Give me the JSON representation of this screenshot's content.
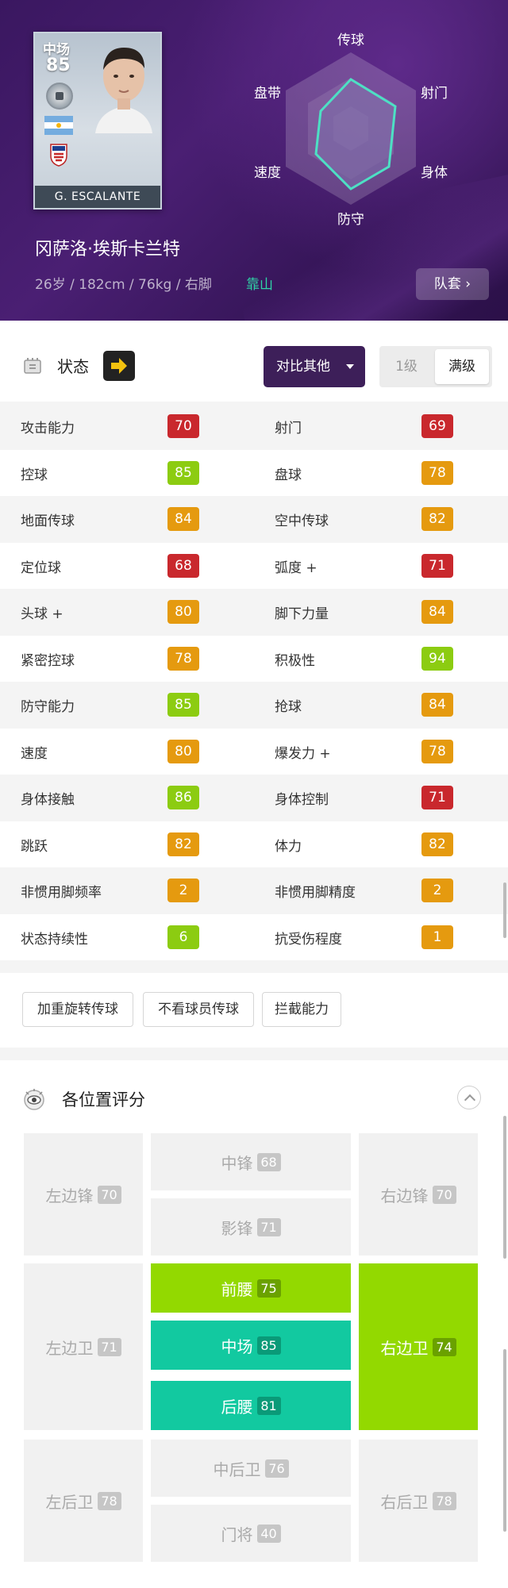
{
  "player": {
    "card_position": "中场",
    "overall": "85",
    "card_name": "G. ESCALANTE",
    "full_name": "冈萨洛·埃斯卡兰特",
    "meta": "26岁 / 182cm / 76kg / 右脚",
    "play_style": "靠山",
    "kit_button": "队套 ›"
  },
  "radar": {
    "labels": [
      "传球",
      "射门",
      "身体",
      "防守",
      "速度",
      "盘带"
    ],
    "colors": {
      "fill": "#7d6aa8",
      "outline": "#4de0c4"
    }
  },
  "status": {
    "label": "状态",
    "compare_button": "对比其他",
    "level_1": "1级",
    "level_max": "满级"
  },
  "stat_colors": {
    "red": "#c9282d",
    "orange": "#e59a0f",
    "green": "#8ccc11"
  },
  "stats": [
    {
      "l_name": "攻击能力",
      "l_val": "70",
      "l_color": "red",
      "r_name": "射门",
      "r_val": "69",
      "r_color": "red"
    },
    {
      "l_name": "控球",
      "l_val": "85",
      "l_color": "green",
      "r_name": "盘球",
      "r_val": "78",
      "r_color": "orange"
    },
    {
      "l_name": "地面传球",
      "l_val": "84",
      "l_color": "orange",
      "r_name": "空中传球",
      "r_val": "82",
      "r_color": "orange"
    },
    {
      "l_name": "定位球",
      "l_val": "68",
      "l_color": "red",
      "r_name": "弧度 +",
      "r_val": "71",
      "r_color": "red"
    },
    {
      "l_name": "头球 +",
      "l_val": "80",
      "l_color": "orange",
      "r_name": "脚下力量",
      "r_val": "84",
      "r_color": "orange"
    },
    {
      "l_name": "紧密控球",
      "l_val": "78",
      "l_color": "orange",
      "r_name": "积极性",
      "r_val": "94",
      "r_color": "green"
    },
    {
      "l_name": "防守能力",
      "l_val": "85",
      "l_color": "green",
      "r_name": "抢球",
      "r_val": "84",
      "r_color": "orange"
    },
    {
      "l_name": "速度",
      "l_val": "80",
      "l_color": "orange",
      "r_name": "爆发力 +",
      "r_val": "78",
      "r_color": "orange"
    },
    {
      "l_name": "身体接触",
      "l_val": "86",
      "l_color": "green",
      "r_name": "身体控制",
      "r_val": "71",
      "r_color": "red"
    },
    {
      "l_name": "跳跃",
      "l_val": "82",
      "l_color": "orange",
      "r_name": "体力",
      "r_val": "82",
      "r_color": "orange"
    },
    {
      "l_name": "非惯用脚频率",
      "l_val": "2",
      "l_color": "orange",
      "r_name": "非惯用脚精度",
      "r_val": "2",
      "r_color": "orange"
    },
    {
      "l_name": "状态持续性",
      "l_val": "6",
      "l_color": "green",
      "r_name": "抗受伤程度",
      "r_val": "1",
      "r_color": "orange"
    }
  ],
  "skills": [
    "加重旋转传球",
    "不看球员传球",
    "拦截能力"
  ],
  "positions": {
    "title": "各位置评分",
    "tiles": [
      {
        "name": "左边锋",
        "value": "70",
        "style": "grey"
      },
      {
        "name": "中锋",
        "value": "68",
        "style": "grey"
      },
      {
        "name": "影锋",
        "value": "71",
        "style": "grey"
      },
      {
        "name": "右边锋",
        "value": "70",
        "style": "grey"
      },
      {
        "name": "左边卫",
        "value": "71",
        "style": "grey"
      },
      {
        "name": "前腰",
        "value": "75",
        "style": "green"
      },
      {
        "name": "中场",
        "value": "85",
        "style": "teal"
      },
      {
        "name": "后腰",
        "value": "81",
        "style": "teal"
      },
      {
        "name": "右边卫",
        "value": "74",
        "style": "green"
      },
      {
        "name": "左后卫",
        "value": "78",
        "style": "grey"
      },
      {
        "name": "中后卫",
        "value": "76",
        "style": "grey"
      },
      {
        "name": "门将",
        "value": "40",
        "style": "grey"
      },
      {
        "name": "右后卫",
        "value": "78",
        "style": "grey"
      }
    ]
  }
}
